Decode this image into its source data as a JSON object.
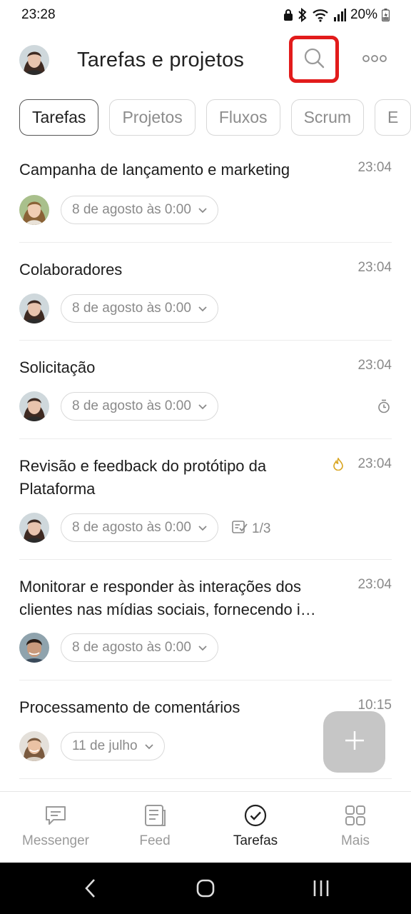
{
  "status_bar": {
    "time": "23:28",
    "battery": "20%"
  },
  "header": {
    "title": "Tarefas e projetos"
  },
  "tabs": [
    {
      "label": "Tarefas",
      "active": true
    },
    {
      "label": "Projetos",
      "active": false
    },
    {
      "label": "Fluxos",
      "active": false
    },
    {
      "label": "Scrum",
      "active": false
    },
    {
      "label": "E",
      "active": false
    }
  ],
  "tasks": [
    {
      "title": "Campanha de lançamento e marketing",
      "time": "23:04",
      "deadline": "8 de agosto às 0:00"
    },
    {
      "title": "Colaboradores",
      "time": "23:04",
      "deadline": "8 de agosto às 0:00"
    },
    {
      "title": "Solicitação",
      "time": "23:04",
      "deadline": "8 de agosto às 0:00"
    },
    {
      "title": "Revisão e feedback do protótipo da Plataforma",
      "time": "23:04",
      "deadline": "8 de agosto às 0:00",
      "checklist": "1/3"
    },
    {
      "title": "Monitorar e responder às interações dos clientes nas mídias sociais, fornecendo i…",
      "time": "23:04",
      "deadline": "8 de agosto às 0:00"
    },
    {
      "title": "Processamento de comentários",
      "time": "10:15",
      "deadline": "11 de julho"
    }
  ],
  "bottom_nav": [
    {
      "label": "Messenger",
      "icon": "chat-icon"
    },
    {
      "label": "Feed",
      "icon": "feed-icon"
    },
    {
      "label": "Tarefas",
      "icon": "check-circle-icon",
      "active": true
    },
    {
      "label": "Mais",
      "icon": "grid-icon"
    }
  ],
  "colors": {
    "highlight": "#e21b1b",
    "flame": "#d9a520",
    "fab": "#c6c6c6"
  }
}
